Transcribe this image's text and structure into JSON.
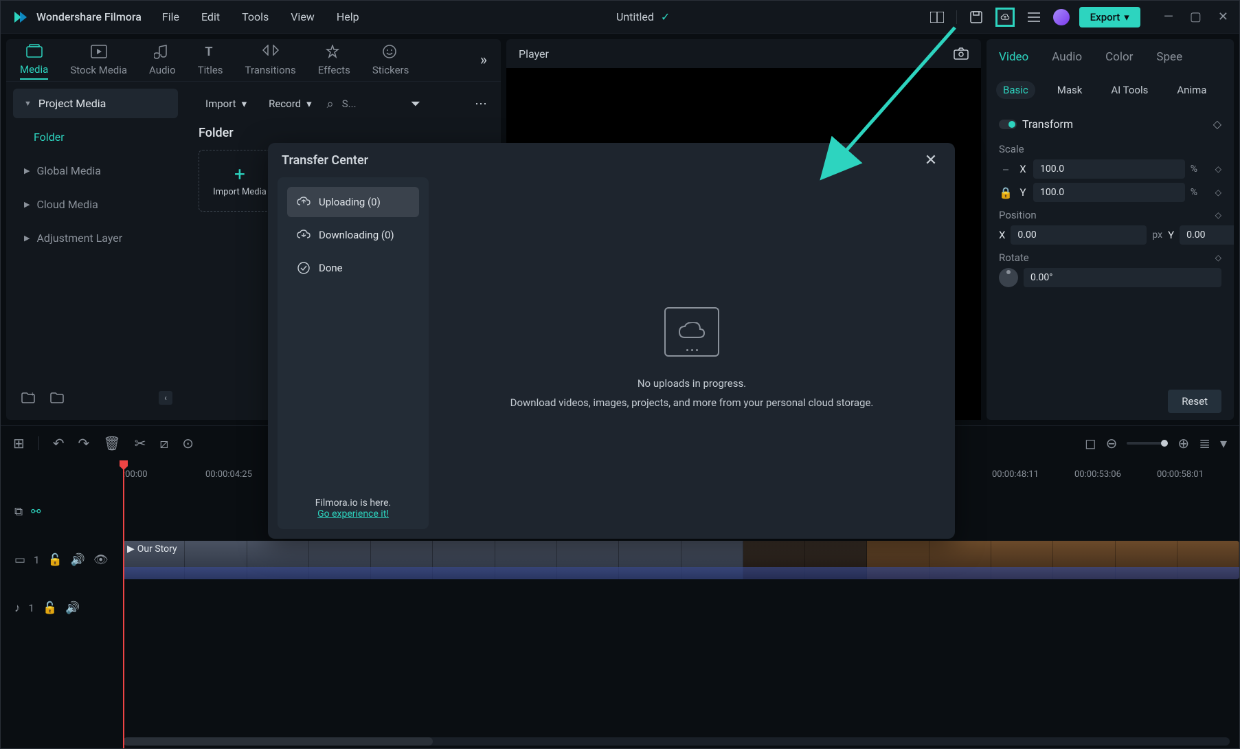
{
  "titlebar": {
    "app_name": "Wondershare Filmora",
    "menu": [
      "File",
      "Edit",
      "Tools",
      "View",
      "Help"
    ],
    "project_name": "Untitled",
    "export_label": "Export"
  },
  "tabs": [
    "Media",
    "Stock Media",
    "Audio",
    "Titles",
    "Transitions",
    "Effects",
    "Stickers"
  ],
  "sidebar": {
    "head": "Project Media",
    "selected": "Folder",
    "items": [
      "Global Media",
      "Cloud Media",
      "Adjustment Layer"
    ]
  },
  "media": {
    "import_dd": "Import",
    "record_dd": "Record",
    "search_placeholder": "S...",
    "folder_label": "Folder",
    "import_media": "Import Media"
  },
  "player": {
    "label": "Player"
  },
  "inspector": {
    "tabs": [
      "Video",
      "Audio",
      "Color",
      "Spee"
    ],
    "subtabs": [
      "Basic",
      "Mask",
      "AI Tools",
      "Anima"
    ],
    "transform": "Transform",
    "scale": "Scale",
    "position": "Position",
    "rotate": "Rotate",
    "x": "X",
    "y": "Y",
    "scale_x": "100.0",
    "scale_y": "100.0",
    "pos_x": "0.00",
    "pos_y": "0.00",
    "rotate_val": "0.00°",
    "pct": "%",
    "px": "px",
    "reset": "Reset"
  },
  "timeline": {
    "marks": [
      ":00:00",
      "00:00:04:25"
    ],
    "marks_right": [
      "00:00:48:11",
      "00:00:53:06",
      "00:00:58:01"
    ],
    "clip_title": "Our Story"
  },
  "modal": {
    "title": "Transfer Center",
    "tabs": {
      "uploading": "Uploading (0)",
      "downloading": "Downloading (0)",
      "done": "Done"
    },
    "empty_line1": "No uploads in progress.",
    "empty_line2": "Download videos, images, projects, and more from your personal cloud storage.",
    "foot1": "Filmora.io is here.",
    "foot2": "Go experience it!"
  }
}
